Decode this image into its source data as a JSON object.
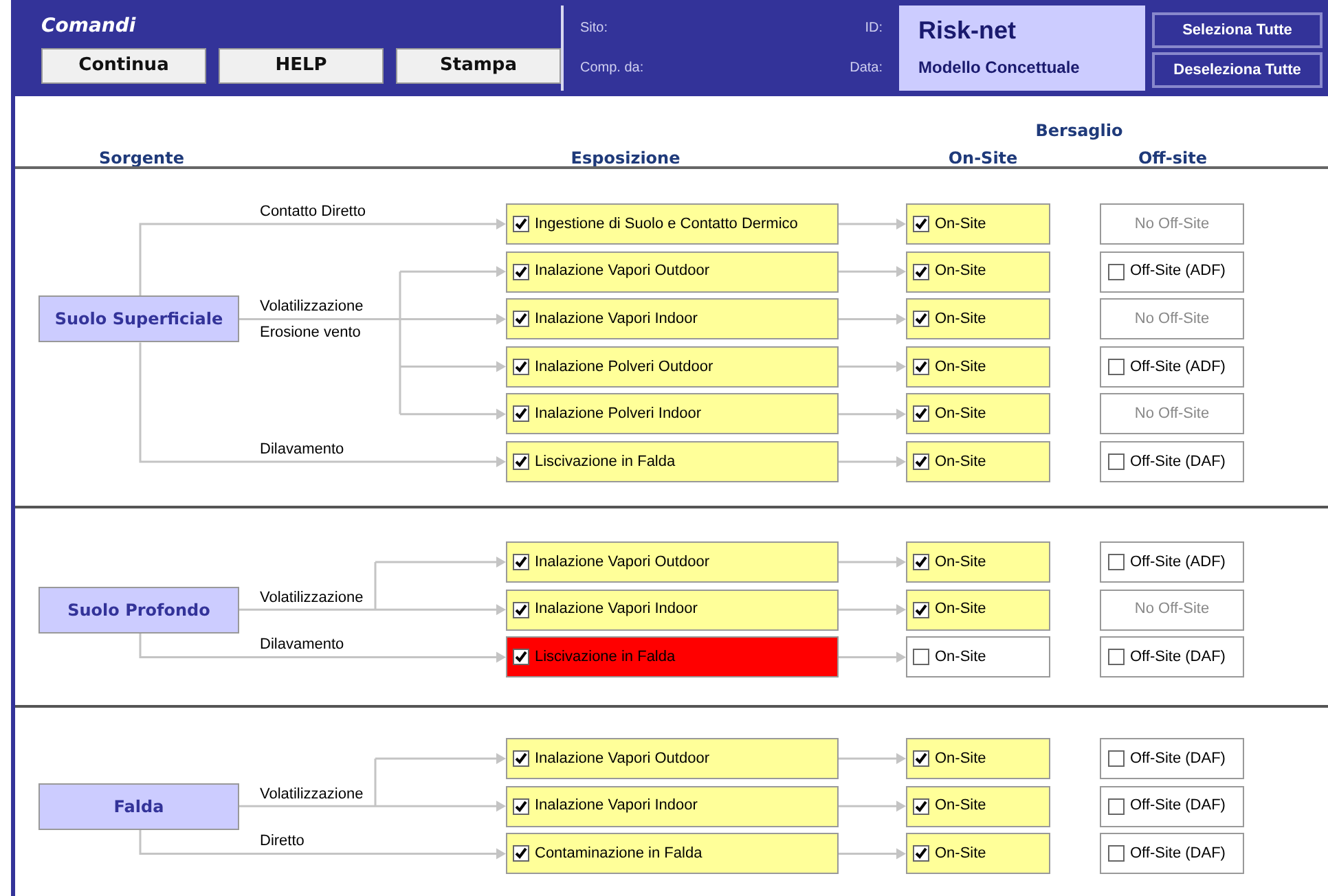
{
  "header": {
    "title": "Comandi",
    "buttons": [
      "Continua",
      "HELP",
      "Stampa"
    ],
    "info": [
      {
        "left": "Sito:",
        "right": "ID:"
      },
      {
        "left": "Comp. da:",
        "right": "Data:"
      }
    ],
    "app": {
      "name": "Risk-net",
      "subtitle": "Modello Concettuale"
    },
    "selection_buttons": [
      "Seleziona Tutte",
      "Deseleziona Tutte"
    ]
  },
  "columns": {
    "source": "Sorgente",
    "exposure": "Esposizione",
    "target": "Bersaglio",
    "on_site": "On-Site",
    "off_site": "Off-site"
  },
  "sources": [
    {
      "name": "Suolo Superficiale",
      "pathways": [
        {
          "labels": [
            "Contatto Diretto"
          ],
          "exposures": [
            {
              "label": "Ingestione di Suolo e Contatto Dermico",
              "checked": true,
              "highlighted": false,
              "on_site": {
                "label": "On-Site",
                "checked": true
              },
              "off_site": {
                "kind": "none",
                "label": "No Off-Site"
              }
            }
          ]
        },
        {
          "labels": [
            "Volatilizzazione",
            "Erosione vento"
          ],
          "exposures": [
            {
              "label": "Inalazione Vapori Outdoor",
              "checked": true,
              "highlighted": false,
              "on_site": {
                "label": "On-Site",
                "checked": true
              },
              "off_site": {
                "kind": "checkbox",
                "label": "Off-Site (ADF)",
                "checked": false
              }
            },
            {
              "label": "Inalazione Vapori Indoor",
              "checked": true,
              "highlighted": false,
              "on_site": {
                "label": "On-Site",
                "checked": true
              },
              "off_site": {
                "kind": "none",
                "label": "No Off-Site"
              }
            },
            {
              "label": "Inalazione Polveri Outdoor",
              "checked": true,
              "highlighted": false,
              "on_site": {
                "label": "On-Site",
                "checked": true
              },
              "off_site": {
                "kind": "checkbox",
                "label": "Off-Site (ADF)",
                "checked": false
              }
            },
            {
              "label": "Inalazione Polveri Indoor",
              "checked": true,
              "highlighted": false,
              "on_site": {
                "label": "On-Site",
                "checked": true
              },
              "off_site": {
                "kind": "none",
                "label": "No Off-Site"
              }
            }
          ]
        },
        {
          "labels": [
            "Dilavamento"
          ],
          "exposures": [
            {
              "label": "Liscivazione in Falda",
              "checked": true,
              "highlighted": false,
              "on_site": {
                "label": "On-Site",
                "checked": true
              },
              "off_site": {
                "kind": "checkbox",
                "label": "Off-Site (DAF)",
                "checked": false
              }
            }
          ]
        }
      ]
    },
    {
      "name": "Suolo Profondo",
      "pathways": [
        {
          "labels": [
            "Volatilizzazione"
          ],
          "exposures": [
            {
              "label": "Inalazione Vapori Outdoor",
              "checked": true,
              "highlighted": false,
              "on_site": {
                "label": "On-Site",
                "checked": true
              },
              "off_site": {
                "kind": "checkbox",
                "label": "Off-Site (ADF)",
                "checked": false
              }
            },
            {
              "label": "Inalazione Vapori Indoor",
              "checked": true,
              "highlighted": false,
              "on_site": {
                "label": "On-Site",
                "checked": true
              },
              "off_site": {
                "kind": "none",
                "label": "No Off-Site"
              }
            }
          ]
        },
        {
          "labels": [
            "Dilavamento"
          ],
          "exposures": [
            {
              "label": "Liscivazione in Falda",
              "checked": true,
              "highlighted": true,
              "on_site": {
                "label": "On-Site",
                "checked": false
              },
              "off_site": {
                "kind": "checkbox",
                "label": "Off-Site (DAF)",
                "checked": false
              }
            }
          ]
        }
      ]
    },
    {
      "name": "Falda",
      "pathways": [
        {
          "labels": [
            "Volatilizzazione"
          ],
          "exposures": [
            {
              "label": "Inalazione Vapori Outdoor",
              "checked": true,
              "highlighted": false,
              "on_site": {
                "label": "On-Site",
                "checked": true
              },
              "off_site": {
                "kind": "checkbox",
                "label": "Off-Site (DAF)",
                "checked": false
              }
            },
            {
              "label": "Inalazione Vapori Indoor",
              "checked": true,
              "highlighted": false,
              "on_site": {
                "label": "On-Site",
                "checked": true
              },
              "off_site": {
                "kind": "checkbox",
                "label": "Off-Site (DAF)",
                "checked": false
              }
            }
          ]
        },
        {
          "labels": [
            "Diretto"
          ],
          "exposures": [
            {
              "label": "Contaminazione in Falda",
              "checked": true,
              "highlighted": false,
              "on_site": {
                "label": "On-Site",
                "checked": true
              },
              "off_site": {
                "kind": "checkbox",
                "label": "Off-Site (DAF)",
                "checked": false
              }
            }
          ]
        }
      ]
    }
  ]
}
